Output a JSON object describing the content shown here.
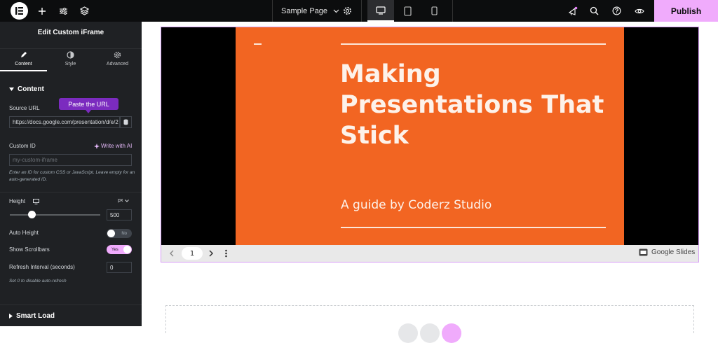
{
  "topbar": {
    "logo_icon": "elementor-logo-icon",
    "page_name": "Sample Page",
    "publish_label": "Publish",
    "accent_color": "#f0abfc"
  },
  "panel": {
    "title": "Edit Custom iFrame",
    "tabs": [
      {
        "label": "Content",
        "icon": "pencil-icon"
      },
      {
        "label": "Style",
        "icon": "half-circle-icon"
      },
      {
        "label": "Advanced",
        "icon": "gear-icon"
      }
    ],
    "content_section": "Content",
    "source_url_label": "Source URL",
    "tooltip": "Paste the URL",
    "source_url_value": "https://docs.google.com/presentation/d/e/2",
    "custom_id_label": "Custom ID",
    "write_ai": "Write with AI",
    "custom_id_placeholder": "my-custom-iframe",
    "custom_id_help": "Enter an ID for custom CSS or JavaScript. Leave empty for an auto-generated ID.",
    "height_label": "Height",
    "height_unit": "px",
    "height_value": "500",
    "height_slider_fraction": 0.25,
    "auto_height_label": "Auto Height",
    "auto_height_state": "No",
    "show_scrollbars_label": "Show Scrollbars",
    "show_scrollbars_state": "Yes",
    "refresh_label": "Refresh Interval (seconds)",
    "refresh_value": "0",
    "refresh_help": "Set 0 to disable auto-refresh",
    "smart_load_section": "Smart Load"
  },
  "slide": {
    "title": "Making Presentations That Stick",
    "subtitle": "A guide by Coderz Studio",
    "page_number": "1",
    "provider": "Google Slides",
    "background_color": "#f26522"
  }
}
